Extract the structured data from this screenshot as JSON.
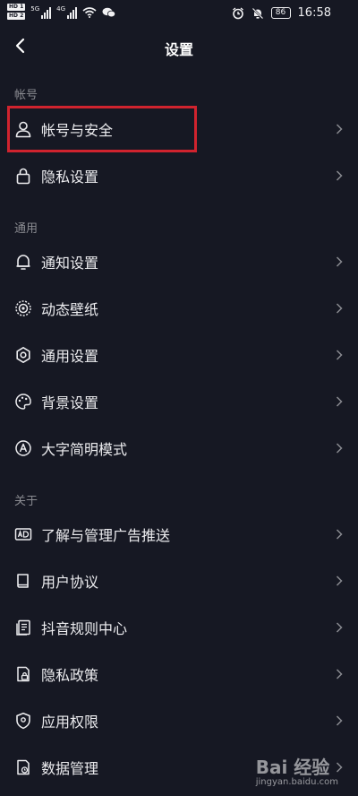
{
  "status_bar": {
    "hd1": "HD 1",
    "hd2": "HD 2",
    "net1": "5G",
    "net2": "4G",
    "battery": "86",
    "time": "16:58"
  },
  "header": {
    "title": "设置"
  },
  "sections": {
    "account": {
      "heading": "帐号",
      "items": [
        {
          "label": "帐号与安全",
          "icon": "user-icon"
        },
        {
          "label": "隐私设置",
          "icon": "lock-icon"
        }
      ]
    },
    "general": {
      "heading": "通用",
      "items": [
        {
          "label": "通知设置",
          "icon": "bell-icon"
        },
        {
          "label": "动态壁纸",
          "icon": "live-wallpaper-icon"
        },
        {
          "label": "通用设置",
          "icon": "gear-icon"
        },
        {
          "label": "背景设置",
          "icon": "palette-icon"
        },
        {
          "label": "大字简明模式",
          "icon": "font-size-icon"
        }
      ]
    },
    "about": {
      "heading": "关于",
      "items": [
        {
          "label": "了解与管理广告推送",
          "icon": "ad-icon"
        },
        {
          "label": "用户协议",
          "icon": "book-icon"
        },
        {
          "label": "抖音规则中心",
          "icon": "document-icon"
        },
        {
          "label": "隐私政策",
          "icon": "privacy-doc-icon"
        },
        {
          "label": "应用权限",
          "icon": "shield-icon"
        },
        {
          "label": "数据管理",
          "icon": "data-icon"
        }
      ]
    }
  },
  "watermark": {
    "brand": "Bai 经验",
    "url": "jingyan.baidu.com"
  },
  "colors": {
    "background": "#161823",
    "highlight": "#d0232e",
    "muted": "#8a8b91"
  }
}
